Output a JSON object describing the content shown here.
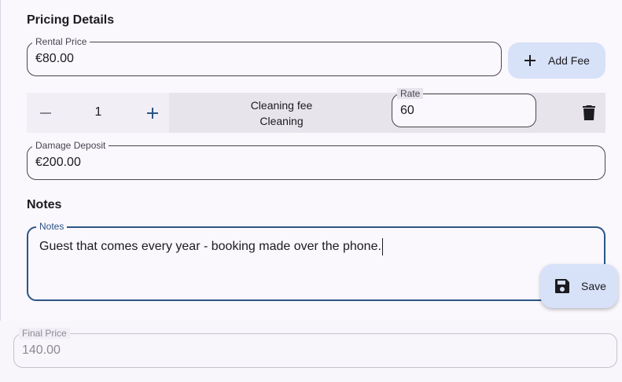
{
  "pricing": {
    "title": "Pricing Details",
    "rental_price_label": "Rental Price",
    "rental_price_value": "€80.00",
    "add_fee_label": "Add Fee"
  },
  "fee": {
    "quantity": "1",
    "name": "Cleaning fee",
    "type": "Cleaning",
    "rate_label": "Rate",
    "rate_value": "60"
  },
  "deposit": {
    "label": "Damage Deposit",
    "value": "€200.00"
  },
  "notes": {
    "title": "Notes",
    "label": "Notes",
    "value": "Guest that comes every year - booking made over the phone."
  },
  "save": {
    "label": "Save"
  },
  "final_price": {
    "label": "Final Price",
    "value": "140.00"
  },
  "colors": {
    "accent": "#2c5585",
    "tonal_button": "#d7e1f8",
    "stepper_plus": "#2c5585"
  },
  "icons": [
    "plus-icon",
    "minus-icon",
    "delete-icon",
    "save-icon"
  ]
}
